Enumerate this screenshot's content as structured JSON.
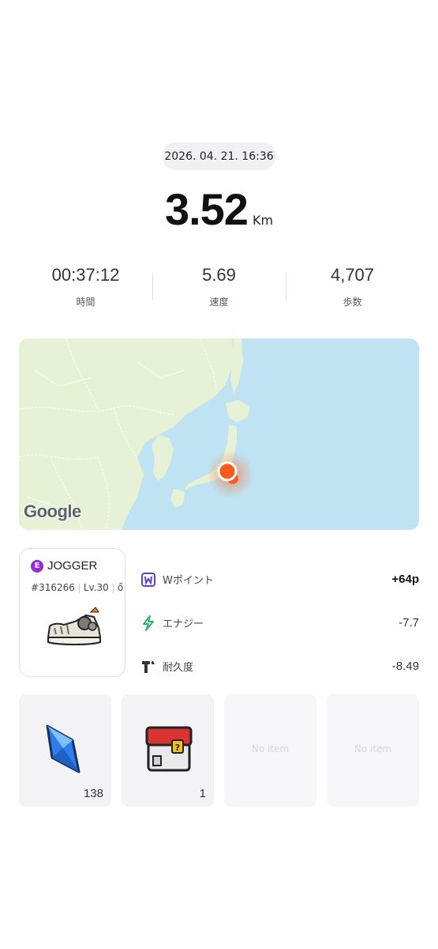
{
  "activity": {
    "datetime": "2026. 04. 21. 16:36",
    "distance": "3.52",
    "distance_unit": "Km"
  },
  "stats": [
    {
      "value": "00:37:12",
      "label": "時間"
    },
    {
      "value": "5.69",
      "label": "速度"
    },
    {
      "value": "4,707",
      "label": "歩数"
    }
  ],
  "map": {
    "attribution": "Google",
    "location_marker": "orange-location-dot"
  },
  "shoe": {
    "rarity_letter": "E",
    "type": "JOGGER",
    "id": "#316266",
    "level": "Lv.30",
    "extra_icon": "ő"
  },
  "results": [
    {
      "icon": "w-point-icon",
      "label": "Wポイント",
      "value": "+64p"
    },
    {
      "icon": "energy-icon",
      "label": "エナジー",
      "value": "-7.7"
    },
    {
      "icon": "durability-icon",
      "label": "耐久度",
      "value": "-8.49"
    }
  ],
  "items": [
    {
      "icon": "blue-gem-icon",
      "count": "138"
    },
    {
      "icon": "mystery-box-icon",
      "count": "1"
    },
    {
      "empty_label": "No item"
    },
    {
      "empty_label": "No item"
    }
  ],
  "colors": {
    "accent_purple": "#9a2cd8",
    "energy_green": "#2fb36b",
    "marker_orange": "#ff5a1a",
    "map_water": "#bfe3f2",
    "map_land": "#e6f1d6"
  }
}
